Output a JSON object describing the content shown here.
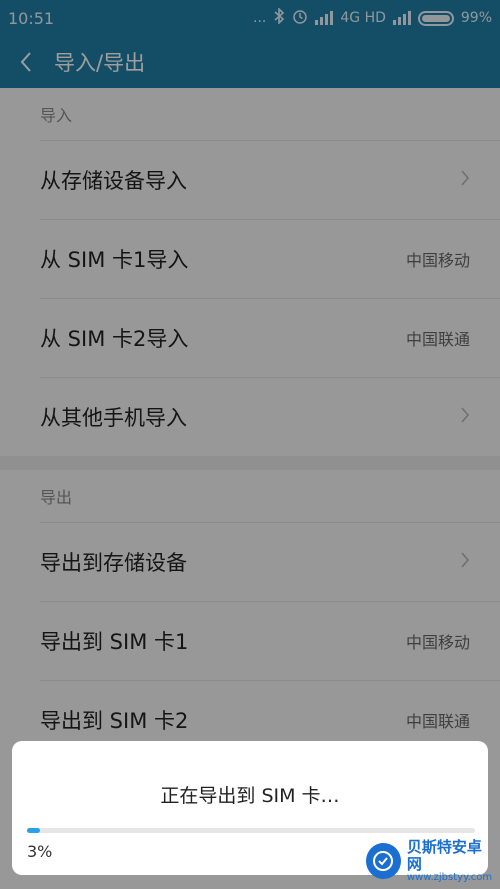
{
  "status_bar": {
    "time": "10:51",
    "dots": "...",
    "network": "4G HD",
    "battery": "99%"
  },
  "header": {
    "title": "导入/导出"
  },
  "import_section": {
    "header": "导入",
    "items": [
      {
        "label": "从存储设备导入",
        "value": ""
      },
      {
        "label": "从 SIM 卡1导入",
        "value": "中国移动"
      },
      {
        "label": "从 SIM 卡2导入",
        "value": "中国联通"
      },
      {
        "label": "从其他手机导入",
        "value": ""
      }
    ]
  },
  "export_section": {
    "header": "导出",
    "items": [
      {
        "label": "导出到存储设备",
        "value": ""
      },
      {
        "label": "导出到 SIM 卡1",
        "value": "中国移动"
      },
      {
        "label": "导出到 SIM 卡2",
        "value": "中国联通"
      }
    ]
  },
  "dialog": {
    "title": "正在导出到  SIM  卡…",
    "progress_percent": 3,
    "progress_text": "3%"
  },
  "watermark": {
    "name": "贝斯特安卓网",
    "url": "www.zjbstyy.com"
  },
  "colors": {
    "accent": "#1f7fa5",
    "progress": "#2aa1e6"
  }
}
